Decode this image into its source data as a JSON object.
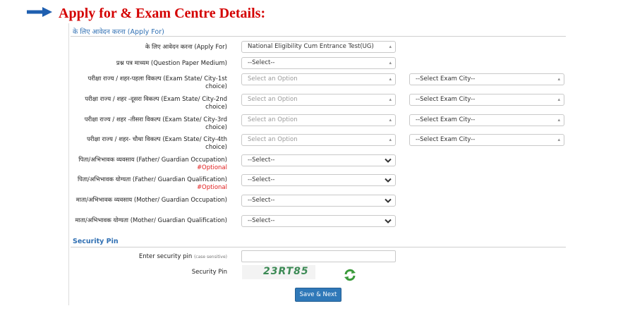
{
  "page": {
    "heading": "Apply for & Exam Centre Details:"
  },
  "apply_section": {
    "title": "के लिए आवेदन करना (Apply For)"
  },
  "rows": [
    {
      "label": "के लिए आवेदन करना (Apply For)",
      "value": "National Eligibility Cum Entrance Test(UG)"
    },
    {
      "label": "प्रश्न पत्र माध्यम (Question Paper Medium)",
      "value": "--Select--"
    },
    {
      "label": "परीक्षा राज्य / शहर-पहला विकल्प (Exam State/ City-1st choice)",
      "state": "Select an Option",
      "city": "--Select Exam City--"
    },
    {
      "label": "परीक्षा राज्य / शहर -दूसरा विकल्प (Exam State/ City-2nd choice)",
      "state": "Select an Option",
      "city": "--Select Exam City--"
    },
    {
      "label": "परीक्षा राज्य / शहर -तीसरा विकल्प (Exam State/ City-3rd choice)",
      "state": "Select an Option",
      "city": "--Select Exam City--"
    },
    {
      "label": "परीक्षा राज्य / शहर- चौथा विकल्प (Exam State/ City-4th choice)",
      "state": "Select an Option",
      "city": "--Select Exam City--"
    },
    {
      "label": "पिता/अभिभावक व्यवसाय (Father/ Guardian Occupation)",
      "optional": "#Optional",
      "value": "--Select--"
    },
    {
      "label": "पिता/अभिभावक योग्यता (Father/ Guardian Qualification)",
      "optional": "#Optional",
      "value": "--Select--"
    },
    {
      "label": "माता/अभिभावक व्यवसाय (Mother/ Guardian Occupation)",
      "value": "--Select--"
    },
    {
      "label": "माता/अभिभावक योग्यता (Mother/ Guardian Qualification)",
      "value": "--Select--"
    }
  ],
  "security": {
    "title": "Security Pin",
    "enter_label": "Enter security pin",
    "case_note": "(case sensitive)",
    "pin_label": "Security Pin",
    "captcha": "23RT85",
    "input_value": ""
  },
  "actions": {
    "submit_label": "Save & Next"
  },
  "colors": {
    "heading": "#d40000",
    "section_title": "#2f6fb3",
    "optional": "#e02020",
    "button": "#2f78b8",
    "refresh_icon": "#3a9a3a"
  }
}
